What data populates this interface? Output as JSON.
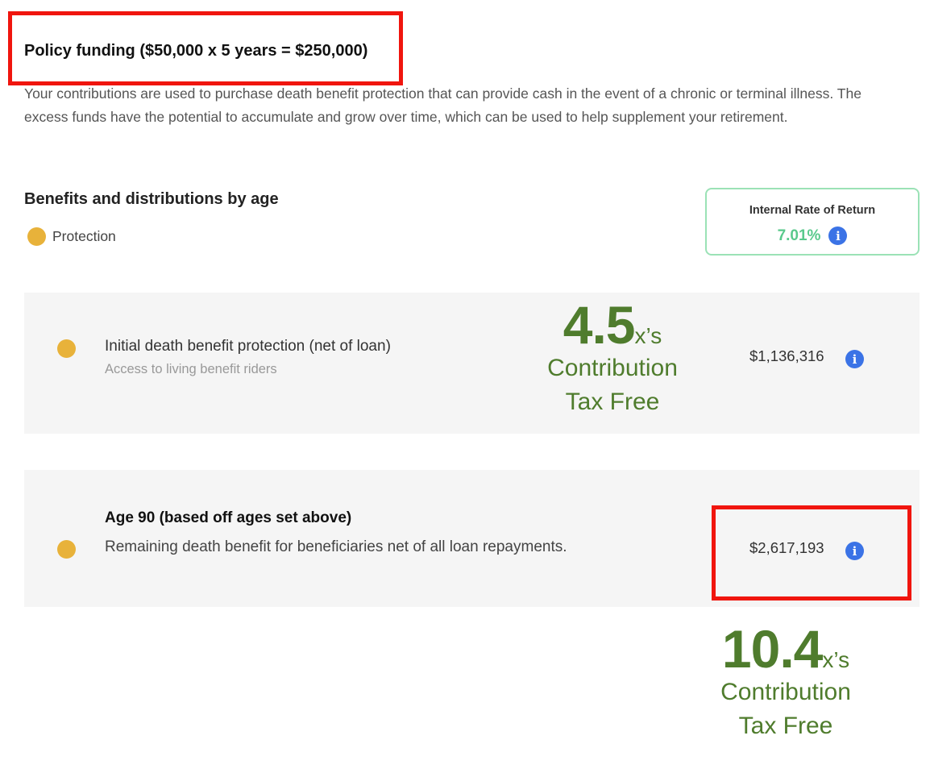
{
  "policy_funding": {
    "title": "Policy funding ($50,000 x 5 years = $250,000)",
    "description": "Your contributions are used to purchase death benefit protection that can provide cash in the event of a chronic or terminal illness. The excess funds have the potential to accumulate and grow over time, which can be used to help supplement your retirement."
  },
  "benefits": {
    "heading": "Benefits and distributions by age",
    "legend_label": "Protection",
    "legend_color": "#e8b23a"
  },
  "irr": {
    "label": "Internal Rate of Return",
    "value": "7.01%",
    "value_color": "#59c98c",
    "info_icon": "i"
  },
  "cards": [
    {
      "title": "Initial death benefit protection (net of loan)",
      "subtitle": "Access to living benefit riders",
      "value": "$1,136,316",
      "info_icon": "i"
    },
    {
      "title": "Age 90 (based off ages set above)",
      "subtitle": "Remaining death benefit for beneficiaries net of all loan repayments.",
      "value": "$2,617,193",
      "info_icon": "i"
    }
  ],
  "overlays": [
    {
      "number": "4.5",
      "suffix": "x’s",
      "line1": "Contribution",
      "line2": "Tax Free"
    },
    {
      "number": "10.4",
      "suffix": "x’s",
      "line1": "Contribution",
      "line2": "Tax Free"
    }
  ],
  "colors": {
    "highlight": "#f0150e",
    "overlay_text": "#4f7c2d",
    "info_icon": "#3b73e6",
    "card_background": "#f5f5f5"
  }
}
